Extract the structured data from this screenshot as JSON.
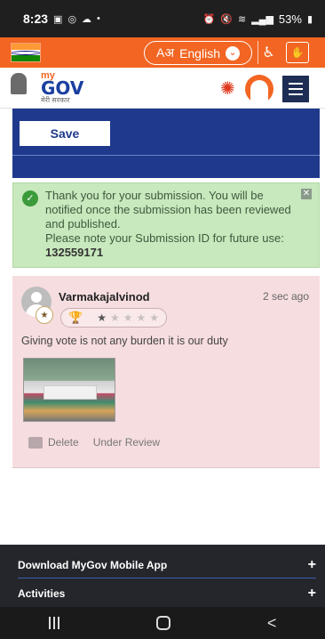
{
  "status_bar": {
    "time": "8:23",
    "battery": "53%",
    "left_icons": [
      "gallery-icon",
      "instagram-icon",
      "cloud-icon",
      "dot-icon"
    ],
    "right_icons": [
      "alarm-icon",
      "mute-icon",
      "wifi-icon",
      "signal-icon",
      "battery-icon"
    ]
  },
  "lang_bar": {
    "language": "English",
    "glyph": "Aअ",
    "colors": {
      "bar": "#f26522"
    }
  },
  "header": {
    "logo_my": "my",
    "logo_gov": "GOV",
    "logo_hindi": "मेरी सरकार"
  },
  "form": {
    "save_label": "Save"
  },
  "alert": {
    "message": "Thank you for your submission. You will be notified once the submission has been reviewed and published.",
    "note": "Please note your Submission ID for future use:",
    "submission_id": "132559171"
  },
  "comment": {
    "author": "Varmakajalvinod",
    "time": "2 sec ago",
    "rating": 1,
    "rating_max": 5,
    "text": "Giving vote is not any burden it is our duty",
    "delete_label": "Delete",
    "status_label": "Under Review"
  },
  "footer": {
    "items": [
      {
        "label": "Download MyGov Mobile App",
        "toggle": "+"
      },
      {
        "label": "Activities",
        "toggle": "+"
      }
    ]
  },
  "nav": {
    "back": "<"
  }
}
